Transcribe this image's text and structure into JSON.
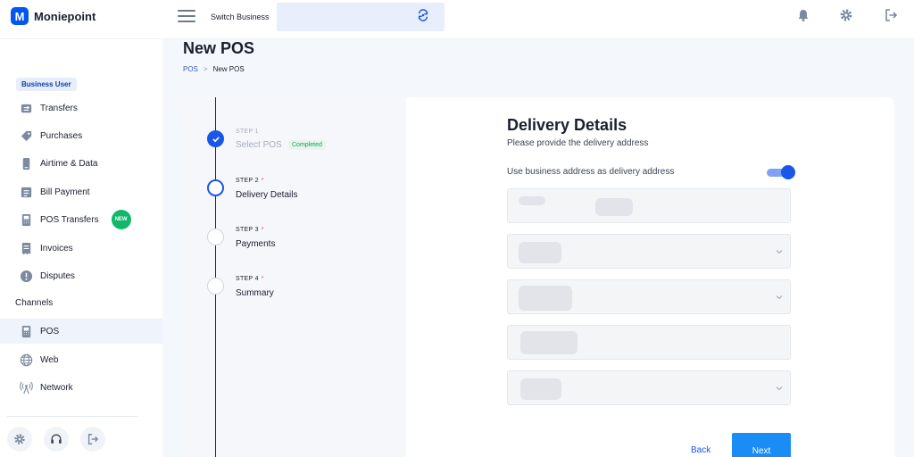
{
  "app": {
    "logo_letter": "M",
    "logo_text": "Moniepoint",
    "brand_color": "#0357ee"
  },
  "topbar": {
    "switch_label": "Switch Business",
    "icons": [
      "menu-icon",
      "switch-icon",
      "bell-icon",
      "gear-icon",
      "logout-icon"
    ]
  },
  "sidebar": {
    "role_badge": "Business User",
    "items": [
      {
        "label": "Transfers",
        "icon": "transfer-icon"
      },
      {
        "label": "Purchases",
        "icon": "tag-icon"
      },
      {
        "label": "Airtime & Data",
        "icon": "phone-icon"
      },
      {
        "label": "Bill Payment",
        "icon": "bill-icon"
      },
      {
        "label": "POS Transfers",
        "icon": "pos-icon",
        "badge": "NEW"
      },
      {
        "label": "Invoices",
        "icon": "invoice-icon"
      },
      {
        "label": "Disputes",
        "icon": "alert-icon"
      }
    ],
    "channels_label": "Channels",
    "channels": [
      {
        "label": "POS",
        "icon": "pos-icon",
        "active": true
      },
      {
        "label": "Web",
        "icon": "globe-icon"
      },
      {
        "label": "Network",
        "icon": "signal-icon"
      }
    ],
    "footer_icons": [
      "settings-icon",
      "support-icon",
      "logout-icon"
    ]
  },
  "page": {
    "title": "New POS",
    "breadcrumb": {
      "root": "POS",
      "separator": ">",
      "current": "New POS"
    }
  },
  "steps": [
    {
      "number": "STEP 1",
      "name": "Select POS",
      "state": "done",
      "tag": "Completed",
      "required": false
    },
    {
      "number": "STEP 2",
      "name": "Delivery Details",
      "state": "current",
      "required": true
    },
    {
      "number": "STEP 3",
      "name": "Payments",
      "state": "pending",
      "required": true
    },
    {
      "number": "STEP 4",
      "name": "Summary",
      "state": "pending",
      "required": true
    }
  ],
  "form": {
    "title": "Delivery Details",
    "subtitle": "Please provide the delivery address",
    "toggle_label": "Use business address as delivery address",
    "toggle_on": true,
    "back_label": "Back",
    "next_label": "Next"
  }
}
